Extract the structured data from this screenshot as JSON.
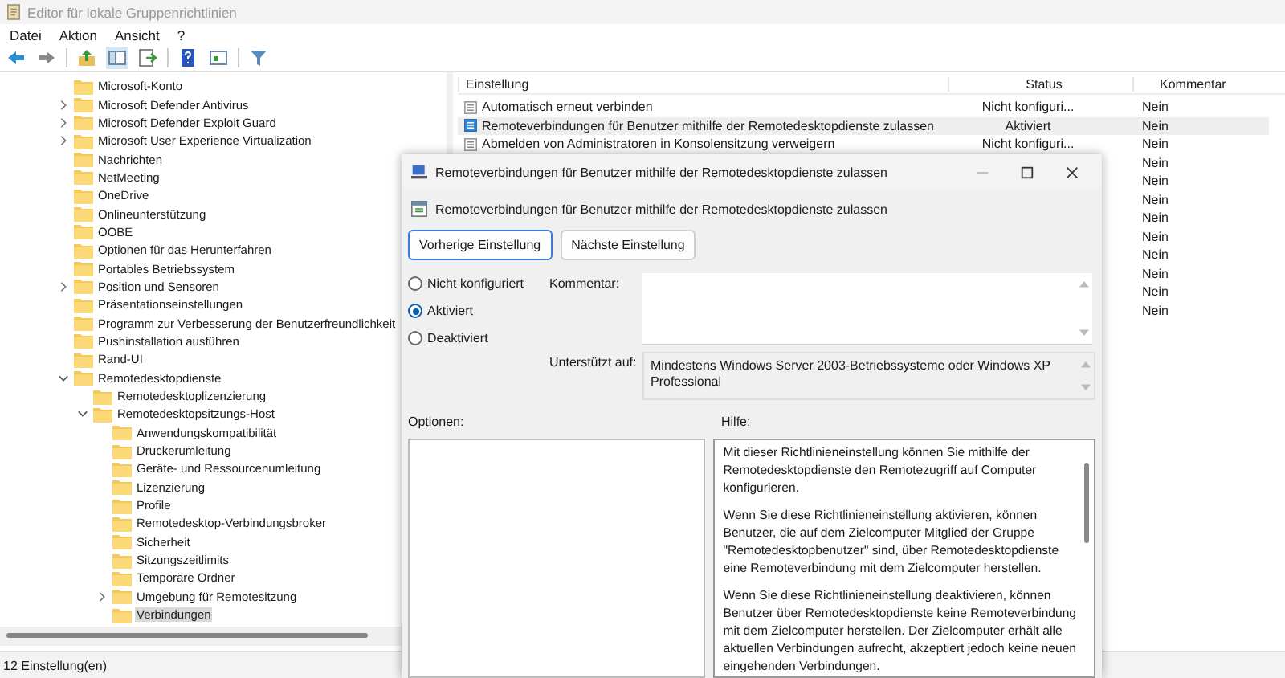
{
  "window": {
    "title": "Editor für lokale Gruppenrichtlinien"
  },
  "menu": [
    "Datei",
    "Aktion",
    "Ansicht",
    "?"
  ],
  "tree": [
    {
      "label": "Microsoft-Konto",
      "selected": false
    },
    {
      "label": "Microsoft Defender Antivirus",
      "expanded": false,
      "selected": false
    },
    {
      "label": "Microsoft Defender Exploit Guard",
      "expanded": false,
      "selected": false
    },
    {
      "label": "Microsoft User Experience Virtualization",
      "expanded": false,
      "selected": false
    },
    {
      "label": "Nachrichten",
      "selected": false
    },
    {
      "label": "NetMeeting",
      "selected": false
    },
    {
      "label": "OneDrive",
      "selected": false
    },
    {
      "label": "Onlineunterstützung",
      "selected": false
    },
    {
      "label": "OOBE",
      "selected": false
    },
    {
      "label": "Optionen für das Herunterfahren",
      "selected": false
    },
    {
      "label": "Portables Betriebssystem",
      "selected": false
    },
    {
      "label": "Position und Sensoren",
      "expanded": false,
      "selected": false
    },
    {
      "label": "Präsentationseinstellungen",
      "selected": false
    },
    {
      "label": "Programm zur Verbesserung der Benutzerfreundlichkeit",
      "selected": false
    },
    {
      "label": "Pushinstallation ausführen",
      "selected": false
    },
    {
      "label": "Rand-UI",
      "selected": false
    },
    {
      "label": "Remotedesktopdienste",
      "expanded": true,
      "selected": false,
      "children": [
        {
          "label": "Remotedesktoplizenzierung",
          "selected": false
        },
        {
          "label": "Remotedesktopsitzungs-Host",
          "expanded": true,
          "selected": false,
          "children": [
            {
              "label": "Anwendungskompatibilität",
              "selected": false
            },
            {
              "label": "Druckerumleitung",
              "selected": false
            },
            {
              "label": "Geräte- und Ressourcenumleitung",
              "selected": false
            },
            {
              "label": "Lizenzierung",
              "selected": false
            },
            {
              "label": "Profile",
              "selected": false
            },
            {
              "label": "Remotedesktop-Verbindungsbroker",
              "selected": false
            },
            {
              "label": "Sicherheit",
              "selected": false
            },
            {
              "label": "Sitzungszeitlimits",
              "selected": false
            },
            {
              "label": "Temporäre Ordner",
              "selected": false
            },
            {
              "label": "Umgebung für Remotesitzung",
              "expanded": false,
              "selected": false
            },
            {
              "label": "Verbindungen",
              "selected": true
            }
          ]
        }
      ]
    }
  ],
  "table": {
    "columns": [
      "Einstellung",
      "Status",
      "Kommentar"
    ],
    "rows": [
      {
        "setting": "Automatisch erneut verbinden",
        "status": "Nicht konfiguri...",
        "comment": "Nein",
        "selected": false
      },
      {
        "setting": "Remoteverbindungen für Benutzer mithilfe der Remotedesktopdienste zulassen",
        "status": "Aktiviert",
        "comment": "Nein",
        "selected": true
      },
      {
        "setting": "Abmelden von Administratoren in Konsolensitzung verweigern",
        "status": "Nicht konfiguri...",
        "comment": "Nein",
        "selected": false
      },
      {
        "comment": "Nein",
        "selected": false
      },
      {
        "comment": "Nein",
        "selected": false
      },
      {
        "comment": "Nein",
        "selected": false
      },
      {
        "comment": "Nein",
        "selected": false
      },
      {
        "comment": "Nein",
        "selected": false
      },
      {
        "comment": "Nein",
        "selected": false
      },
      {
        "comment": "Nein",
        "selected": false
      },
      {
        "comment": "Nein",
        "selected": false
      },
      {
        "comment": "Nein",
        "selected": false
      }
    ]
  },
  "status_bar": "12 Einstellung(en)",
  "dialog": {
    "title": "Remoteverbindungen für Benutzer mithilfe der Remotedesktopdienste zulassen",
    "heading": "Remoteverbindungen für Benutzer mithilfe der Remotedesktopdienste zulassen",
    "buttons": [
      {
        "label": "Vorherige Einstellung",
        "focused": true
      },
      {
        "label": "Nächste Einstellung",
        "focused": false
      }
    ],
    "options": [
      {
        "label": "Nicht konfiguriert",
        "selected": false
      },
      {
        "label": "Aktiviert",
        "selected": true
      },
      {
        "label": "Deaktiviert",
        "selected": false
      }
    ],
    "comment_label": "Kommentar:",
    "supported_label": "Unterstützt auf:",
    "supported_value": "Mindestens Windows Server 2003-Betriebssysteme oder Windows XP Professional",
    "options_label": "Optionen:",
    "help_label": "Hilfe:",
    "help": [
      "Mit dieser Richtlinieneinstellung können Sie mithilfe der Remotedesktopdienste den Remotezugriff auf Computer konfigurieren.",
      "Wenn Sie diese Richtlinieneinstellung aktivieren, können Benutzer, die auf dem Zielcomputer Mitglied der Gruppe \"Remotedesktopbenutzer\" sind, über Remotedesktopdienste eine Remoteverbindung mit dem Zielcomputer herstellen.",
      "Wenn Sie diese Richtlinieneinstellung deaktivieren, können Benutzer über Remotedesktopdienste keine Remoteverbindung mit dem Zielcomputer herstellen. Der Zielcomputer erhält alle aktuellen Verbindungen aufrecht, akzeptiert jedoch keine neuen eingehenden Verbindungen."
    ]
  }
}
